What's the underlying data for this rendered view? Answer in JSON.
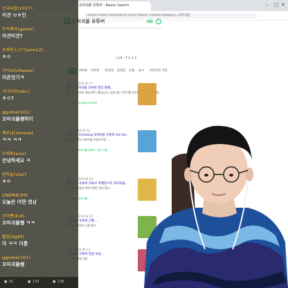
{
  "browser": {
    "tab_title": "꼬마괴물 유튜버 - Naver Search",
    "url": "search.naver.com/search.naver?where=nexearch&query=꼬마괴물"
  },
  "search": {
    "query": "꼬마괴물 유튜버"
  },
  "ranking_row": "‹ 1/4 ›   7  1 2 3",
  "filters": [
    "전체",
    "VIEW",
    "이미지",
    "지식iN",
    "동영상",
    "쇼핑",
    "뉴스",
    "어학사전",
    "지도"
  ],
  "results": [
    {
      "source": "블로그 · 2019.09.17.",
      "title": "[단독] 꼬마괴물 유튜버 영상 화제...",
      "desc": "꼬마괴물 유튜버 채널 관련 내용입니다. 엄청 많은 구독자를 보유한 어린이 유튜버 채널...",
      "tags": "#꼬마괴물 #유튜버 #어린이",
      "thumb_color": "#d9a441"
    },
    {
      "source": "카페 · 2019.09.10.",
      "title": "꼬마괴물 Climbing 꼬마괴물 유튜버 full ide...",
      "desc": "클라이밍 영상 꼬마괴물 유튜버 모음 ...",
      "tags": "You Tube 꼬마괴물 유튜버 · 영상 모음",
      "thumb_color": "#5aa3d6"
    },
    {
      "source": "블로그 · 2019.08.28.",
      "title": "꼬마괴물 유튜버 유튜브 포켓몬스터 꼬마괴물...",
      "desc": "꼬마괴물 유튜버 관련 포켓몬 영상 정리...",
      "tags": "#포켓몬 #꼬마괴물",
      "thumb_color": "#e0b84a"
    },
    {
      "source": "블로그 · 2019.08.20.",
      "title": "꼬마괴물 유튜버 근황 ...",
      "desc": "꼬마괴물 유튜버 근황 정리 ...",
      "tags": "#근황",
      "thumb_color": "#7fb34e"
    },
    {
      "source": "카페 · 2019.08.12.",
      "title": "꼬마괴물 유튜버 영상 모음 ...",
      "desc": "꼬마괴물 관련 영상 ...",
      "tags": "#영상",
      "thumb_color": "#c7546a"
    }
  ],
  "chat": [
    {
      "user": "순대국밥(2017)",
      "text": "미션 ㅁㅎ인"
    },
    {
      "user": "주의해라(gavin)",
      "text": "미션미션?"
    },
    {
      "user": "우래옥소고기(ann12)",
      "text": "ㅎㅇ"
    },
    {
      "user": "지식in(cheese)",
      "text": "아존엉기ㅋ"
    },
    {
      "user": "가나다라(abc)",
      "text": "ㅎㅇ?"
    },
    {
      "user": "ggoma(101)",
      "text": "꼬마괴물쌤하이"
    },
    {
      "user": "제로님(zerona)",
      "text": "ㅋㅋ ㅋㅋ"
    },
    {
      "user": "우래옥(ann)",
      "text": "안녕하세요 ㅋ"
    },
    {
      "user": "밤하늘(star)",
      "text": "ㅎㅇ"
    },
    {
      "user": "CREMA(99)",
      "text": "오늘은 어떤 영상"
    },
    {
      "user": "꼬마팬(kid)",
      "text": "꼬마괴물쌤 ㅋㅋ"
    },
    {
      "user": "별빛(light)",
      "text": "아 ㅋㅋ 이름"
    },
    {
      "user": "ggoma(101)",
      "text": "꼬마괴물쌤"
    }
  ],
  "chat_footer": {
    "viewers": "91",
    "followers": "120",
    "likes": "136"
  }
}
